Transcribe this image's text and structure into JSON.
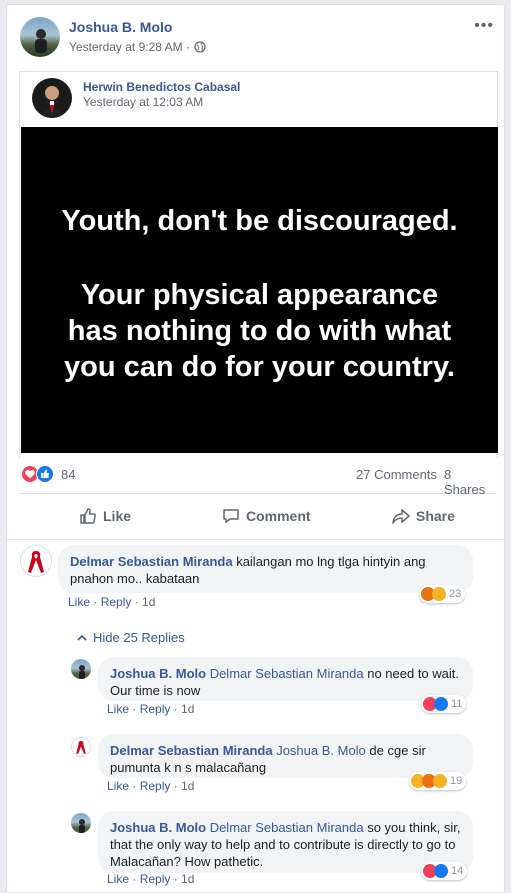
{
  "post": {
    "author": "Joshua B. Molo",
    "time": "Yesterday at 9:28 AM ·",
    "menu": "•••"
  },
  "shared": {
    "author": "Herwin Benedictos Cabasal",
    "time": "Yesterday at 12:03 AM",
    "image_text": [
      "Youth, don't be discouraged.",
      "Your physical appearance",
      "has nothing to do with what",
      "you can do for your country."
    ]
  },
  "stats": {
    "reactions": "84",
    "comments": "27 Comments",
    "shares": "8 Shares"
  },
  "actions": {
    "like": "Like",
    "comment": "Comment",
    "share": "Share"
  },
  "colors": {
    "link": "#385898",
    "like_blue": "#1877f2",
    "love_red": "#f33e58",
    "haha_yellow": "#f7b125"
  },
  "comments": [
    {
      "author": "Delmar Sebastian Miranda",
      "text": "kailangan mo lng tlga hintyin ang pnahon mo.. kabataan",
      "like": "Like",
      "reply": "Reply",
      "age": "1d",
      "reactions": "23",
      "icons": [
        "angry",
        "sad"
      ]
    }
  ],
  "hide_replies": "Hide 25 Replies",
  "replies": [
    {
      "author": "Joshua B. Molo",
      "tag": "Delmar Sebastian Miranda",
      "text": "no need to wait. Our time is now",
      "like": "Like",
      "reply": "Reply",
      "age": "1d",
      "reactions": "11",
      "icons": [
        "love",
        "like"
      ]
    },
    {
      "author": "Delmar Sebastian Miranda",
      "tag": "Joshua B. Molo",
      "text": "de cge sir pumunta k n s malacañang",
      "like": "Like",
      "reply": "Reply",
      "age": "1d",
      "reactions": "19",
      "icons": [
        "haha",
        "angry",
        "sad"
      ]
    },
    {
      "author": "Joshua B. Molo",
      "tag": "Delmar Sebastian Miranda",
      "text": "so you think, sir, that the only way to help and to contribute is directly to go to Malacañan? How pathetic.",
      "like": "Like",
      "reply": "Reply",
      "age": "1d",
      "reactions": "14",
      "icons": [
        "love",
        "like"
      ]
    }
  ]
}
